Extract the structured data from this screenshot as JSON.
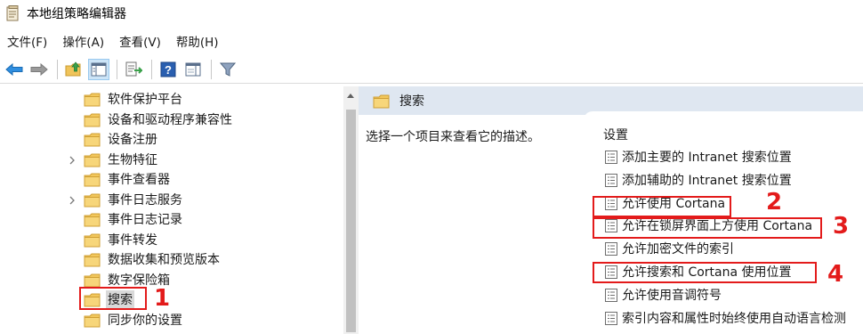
{
  "window": {
    "title": "本地组策略编辑器"
  },
  "menu": {
    "file": "文件(F)",
    "action": "操作(A)",
    "view": "查看(V)",
    "help": "帮助(H)"
  },
  "tree": {
    "items": [
      {
        "label": "软件保护平台",
        "expandable": false
      },
      {
        "label": "设备和驱动程序兼容性",
        "expandable": false
      },
      {
        "label": "设备注册",
        "expandable": false
      },
      {
        "label": "生物特征",
        "expandable": true
      },
      {
        "label": "事件查看器",
        "expandable": false
      },
      {
        "label": "事件日志服务",
        "expandable": true
      },
      {
        "label": "事件日志记录",
        "expandable": false
      },
      {
        "label": "事件转发",
        "expandable": false
      },
      {
        "label": "数据收集和预览版本",
        "expandable": false
      },
      {
        "label": "数字保险箱",
        "expandable": false
      },
      {
        "label": "搜索",
        "expandable": false,
        "selected": true
      },
      {
        "label": "同步你的设置",
        "expandable": false
      }
    ]
  },
  "details": {
    "header": "搜索",
    "description": "选择一个项目来查看它的描述。",
    "settings_column": "设置",
    "settings": [
      "添加主要的 Intranet 搜索位置",
      "添加辅助的 Intranet 搜索位置",
      "允许使用 Cortana",
      "允许在锁屏界面上方使用 Cortana",
      "允许加密文件的索引",
      "允许搜索和 Cortana 使用位置",
      "允许使用音调符号",
      "索引内容和属性时始终使用自动语言检测"
    ]
  },
  "annotations": {
    "n1": "1",
    "n2": "2",
    "n3": "3",
    "n4": "4",
    "color": "#e31b1b"
  }
}
